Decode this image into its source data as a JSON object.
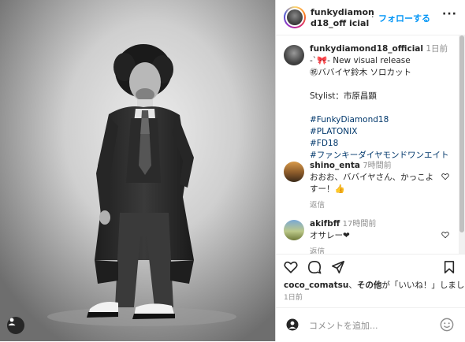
{
  "post": {
    "username": "funkydiamond18_official",
    "header_username": "funkydiamond18_off icial",
    "follow_label": "フォローする",
    "more_label": "···",
    "caption_time": "1日前",
    "caption_lines": [
      "-`🎀- New visual release",
      "㊗ババイヤ鈴木 ソロカット",
      "",
      "Stylist：市原昌顕"
    ],
    "hashtags": [
      "#FunkyDiamond18",
      "#PLATONIX",
      "#FD18",
      "#ファンキーダイヤモンドワンエイト"
    ]
  },
  "comments": [
    {
      "username": "shino_enta",
      "time": "7時間前",
      "text": "おおお、ババイヤさん、かっこよすー！👍",
      "reply_label": "返信"
    },
    {
      "username": "akifbff",
      "time": "17時間前",
      "text": "オサレー❤",
      "reply_label": "返信"
    }
  ],
  "likes": {
    "user": "coco_comatsu",
    "suffix_bold": "その他",
    "suffix": "が「いいね！」しました"
  },
  "date": "1日前",
  "add_comment": {
    "placeholder": "コメントを追加..."
  },
  "colors": {
    "link": "#0095f6",
    "hashtag": "#00376b",
    "muted": "#8e8e8e"
  }
}
